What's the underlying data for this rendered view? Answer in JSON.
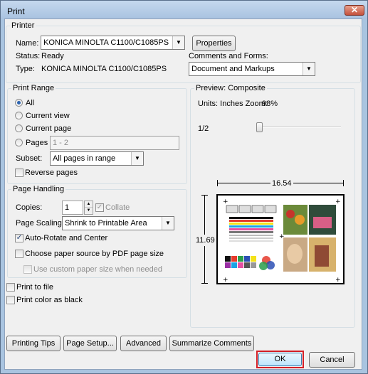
{
  "window": {
    "title": "Print",
    "close_label": "✕"
  },
  "printer": {
    "group_label": "Printer",
    "name_label": "Name:",
    "name_value": "KONICA MINOLTA C1100/C1085PS",
    "properties_label": "Properties",
    "status_label": "Status:",
    "status_value": "Ready",
    "type_label": "Type:",
    "type_value": "KONICA MINOLTA C1100/C1085PS",
    "comments_label": "Comments and Forms:",
    "comments_value": "Document and Markups"
  },
  "print_range": {
    "group_label": "Print Range",
    "all_label": "All",
    "current_view_label": "Current view",
    "current_page_label": "Current page",
    "pages_label": "Pages",
    "pages_value": "1 - 2",
    "subset_label": "Subset:",
    "subset_value": "All pages in range",
    "reverse_label": "Reverse pages",
    "selected": "All"
  },
  "page_handling": {
    "group_label": "Page Handling",
    "copies_label": "Copies:",
    "copies_value": "1",
    "collate_label": "Collate",
    "scaling_label": "Page Scaling:",
    "scaling_value": "Shrink to Printable Area",
    "auto_rotate_label": "Auto-Rotate and Center",
    "auto_rotate_checked": true,
    "paper_source_label": "Choose paper source by PDF page size",
    "custom_paper_label": "Use custom paper size when needed"
  },
  "options": {
    "print_to_file_label": "Print to file",
    "color_as_black_label": "Print color as black"
  },
  "preview": {
    "group_label": "Preview: Composite",
    "units_label": "Units: Inches Zoom:",
    "zoom_value": "98%",
    "page_indicator": "1/2",
    "width_label": "16.54",
    "height_label": "11.69"
  },
  "buttons": {
    "printing_tips": "Printing Tips",
    "page_setup": "Page Setup...",
    "advanced": "Advanced",
    "summarize_comments": "Summarize Comments",
    "ok": "OK",
    "cancel": "Cancel"
  },
  "colors": {
    "ok_focus_border": "#d42027",
    "radio_accent": "#2c64b1"
  }
}
